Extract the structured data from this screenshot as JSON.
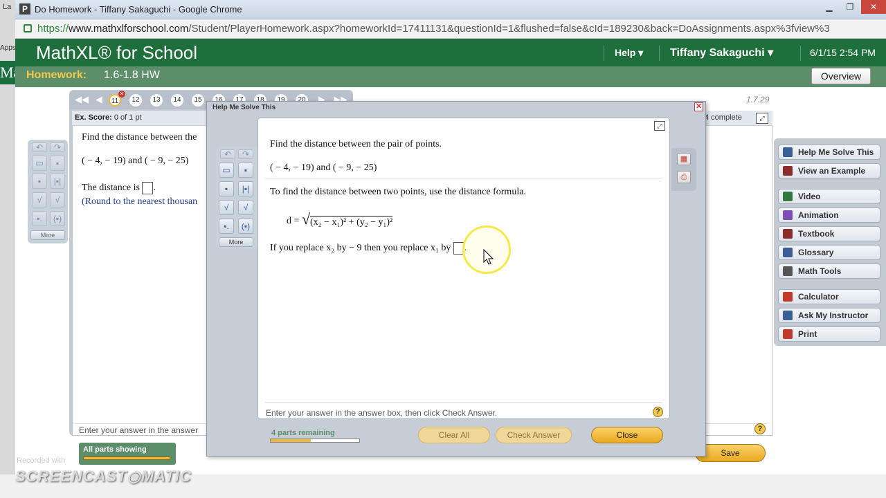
{
  "desktop": {
    "frag1": "La",
    "frag2": "Apps",
    "frag3": "Ma"
  },
  "browser": {
    "window_title": "Do Homework - Tiffany Sakaguchi - Google Chrome",
    "favicon": "P",
    "url_prefix": "https://",
    "url_host": "www.mathxlforschool.com",
    "url_rest": "/Student/PlayerHomework.aspx?homeworkId=17411131&questionId=1&flushed=false&cId=189230&back=DoAssignments.aspx%3fview%3"
  },
  "header": {
    "brand": "MathXL® for School",
    "help": "Help ▾",
    "user": "Tiffany Sakaguchi ▾",
    "datetime": "6/1/15 2:54 PM"
  },
  "homework": {
    "label": "Homework:",
    "name": "1.6-1.8 HW",
    "overview": "Overview",
    "version": "1.7.29"
  },
  "question_nav": {
    "numbers": [
      "11",
      "12",
      "13",
      "14",
      "15",
      "16",
      "17",
      "18",
      "19",
      "20"
    ],
    "current": "11"
  },
  "score": {
    "label": "Ex. Score:",
    "value": "0 of 1 pt",
    "complete": "4 complete"
  },
  "question": {
    "prompt": "Find the distance between the",
    "points": "( − 4, − 19) and ( − 9, − 25)",
    "answer_label": "The distance is",
    "round_note": "(Round to the nearest thousan"
  },
  "bottom": {
    "hint": "Enter your answer in the answer",
    "all_parts": "All parts showing",
    "save": "Save",
    "qmark": "?"
  },
  "side_buttons": [
    {
      "label": "Help Me Solve This",
      "icon": "key-icon",
      "color": "#3a5f96"
    },
    {
      "label": "View an Example",
      "icon": "example-icon",
      "color": "#8e2c2c"
    },
    {
      "label": "Video",
      "icon": "video-icon",
      "color": "#2f7a3e"
    },
    {
      "label": "Animation",
      "icon": "animation-icon",
      "color": "#7b4fb3"
    },
    {
      "label": "Textbook",
      "icon": "textbook-icon",
      "color": "#8e2c2c"
    },
    {
      "label": "Glossary",
      "icon": "glossary-icon",
      "color": "#3a5f96"
    },
    {
      "label": "Math Tools",
      "icon": "tools-icon",
      "color": "#555555"
    },
    {
      "label": "Calculator",
      "icon": "calculator-icon",
      "color": "#c0392b"
    },
    {
      "label": "Ask My Instructor",
      "icon": "ask-icon",
      "color": "#3a5f96"
    },
    {
      "label": "Print",
      "icon": "print-icon",
      "color": "#c0392b"
    }
  ],
  "palette": {
    "more": "More"
  },
  "modal": {
    "title": "Help Me Solve This",
    "prompt": "Find the distance between the pair of points.",
    "points": "( − 4, − 19) and ( − 9, − 25)",
    "instruction": "To find the distance between two points, use the distance formula.",
    "formula_lhs": "d =",
    "formula_rhs": "(x₂ − x₁)² + (y₂ − y₁)²",
    "replace_text": "If you replace x₂ by  − 9 then you replace x₁ by",
    "hint": "Enter your answer in the answer box, then click Check Answer.",
    "parts_remaining": "4 parts remaining",
    "parts_progress": 0.45,
    "clear_all": "Clear All",
    "check_answer": "Check Answer",
    "close": "Close"
  },
  "watermark": {
    "recorded": "Recorded with",
    "brand": "SCREENCAST◉MATIC"
  }
}
